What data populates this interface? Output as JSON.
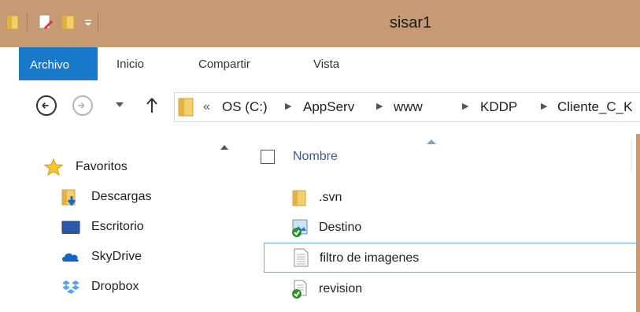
{
  "window": {
    "title": "sisar1"
  },
  "ribbon": {
    "tabs": [
      {
        "label": "Archivo",
        "active": true
      },
      {
        "label": "Inicio"
      },
      {
        "label": "Compartir"
      },
      {
        "label": "Vista"
      }
    ]
  },
  "address": {
    "overflow": "«",
    "crumbs": [
      "OS (C:)",
      "AppServ",
      "www",
      "KDDP",
      "Cliente_C_K"
    ]
  },
  "navpane": {
    "favorites_label": "Favoritos",
    "items": [
      {
        "label": "Descargas",
        "icon": "downloads-folder-icon"
      },
      {
        "label": "Escritorio",
        "icon": "desktop-icon"
      },
      {
        "label": "SkyDrive",
        "icon": "skydrive-icon"
      },
      {
        "label": "Dropbox",
        "icon": "dropbox-icon"
      }
    ]
  },
  "filelist": {
    "column_name": "Nombre",
    "files": [
      {
        "name": ".svn",
        "icon": "folder-icon"
      },
      {
        "name": "Destino",
        "icon": "svn-image-icon"
      },
      {
        "name": "filtro de imagenes",
        "icon": "text-file-icon",
        "focused": true
      },
      {
        "name": "revision",
        "icon": "svn-file-icon"
      }
    ]
  },
  "colors": {
    "titlebar": "#c69a72",
    "accent": "#1979ca",
    "folder": "#e8c15a",
    "svn_green": "#2f8f2f"
  }
}
